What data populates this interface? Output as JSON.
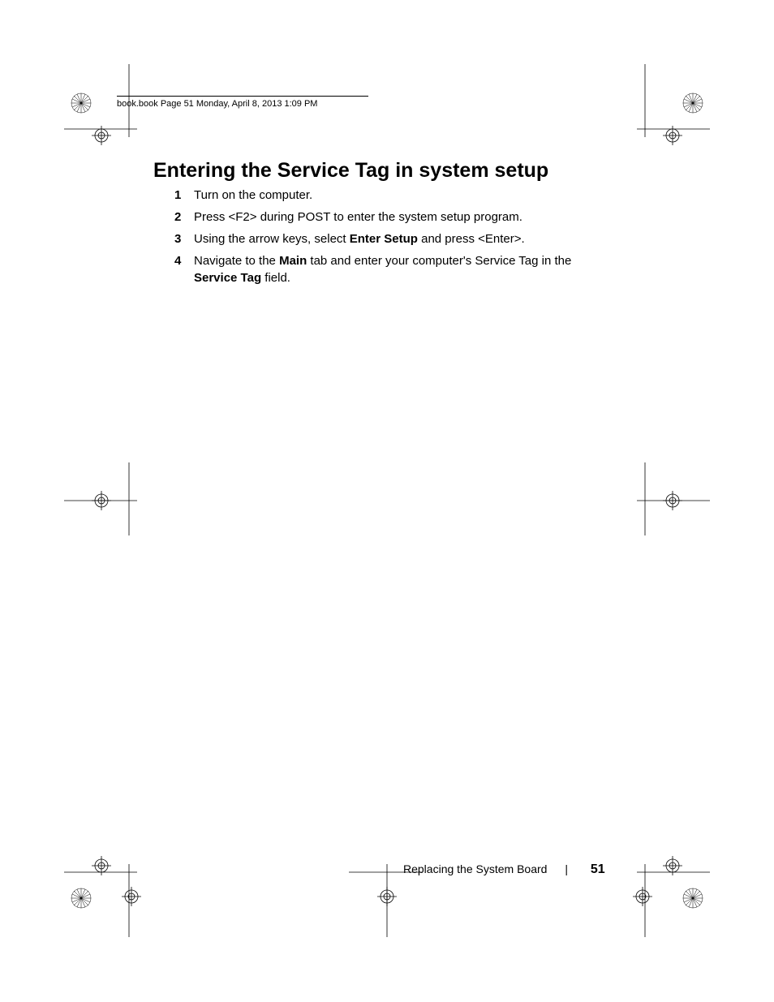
{
  "header": {
    "running_head": "book.book  Page 51  Monday, April 8, 2013  1:09 PM"
  },
  "heading": "Entering the Service Tag in system setup",
  "steps": [
    {
      "num": "1",
      "parts": [
        {
          "t": "Turn on the computer."
        }
      ]
    },
    {
      "num": "2",
      "parts": [
        {
          "t": "Press <F2> during POST to enter the system setup program."
        }
      ]
    },
    {
      "num": "3",
      "parts": [
        {
          "t": "Using the arrow keys, select "
        },
        {
          "t": "Enter Setup",
          "b": true
        },
        {
          "t": " and press <Enter>."
        }
      ]
    },
    {
      "num": "4",
      "parts": [
        {
          "t": "Navigate to the "
        },
        {
          "t": "Main",
          "b": true
        },
        {
          "t": " tab and enter your computer's Service Tag in the "
        },
        {
          "t": "Service Tag",
          "b": true
        },
        {
          "t": " field."
        }
      ]
    }
  ],
  "footer": {
    "section": "Replacing the System Board",
    "separator": "|",
    "page": "51"
  }
}
